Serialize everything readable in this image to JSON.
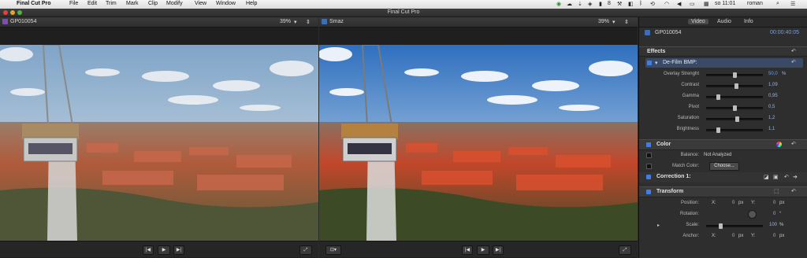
{
  "menubar": {
    "app": "Final Cut Pro",
    "items": [
      "File",
      "Edit",
      "Trim",
      "Mark",
      "Clip",
      "Modify",
      "View",
      "Window",
      "Help"
    ],
    "status": {
      "battery_count": "8",
      "clock": "so 11:01",
      "user": "roman"
    }
  },
  "window": {
    "title": "Final Cut Pro"
  },
  "viewer_left": {
    "clip_name": "GP010054",
    "zoom": "39%"
  },
  "viewer_right": {
    "clip_name": "Smaz",
    "zoom": "39%"
  },
  "inspector": {
    "tabs": [
      "Video",
      "Audio",
      "Info"
    ],
    "clip_name": "GP010054",
    "timecode": "00:00:40:05",
    "effects_heading": "Effects",
    "effect": {
      "name": "De-Film BMP:",
      "params": [
        {
          "label": "Overlay Strenght",
          "value": "50,0",
          "unit": "%",
          "level": 0.5
        },
        {
          "label": "Contrast",
          "value": "1,09",
          "unit": "",
          "level": 0.54
        },
        {
          "label": "Gamma",
          "value": "0,95",
          "unit": "",
          "level": 0.2
        },
        {
          "label": "Pivot",
          "value": "0,5",
          "unit": "",
          "level": 0.5
        },
        {
          "label": "Saturation",
          "value": "1,2",
          "unit": "",
          "level": 0.55
        },
        {
          "label": "Brightness",
          "value": "1,1",
          "unit": "",
          "level": 0.2
        }
      ]
    },
    "color": {
      "heading": "Color",
      "balance_label": "Balance:",
      "balance_value": "Not Analyzed",
      "match_label": "Match Color:",
      "match_button": "Choose...",
      "correction": "Correction 1:"
    },
    "transform": {
      "heading": "Transform",
      "position_label": "Position:",
      "x_label": "X:",
      "y_label": "Y:",
      "pos_x": "0",
      "pos_y": "0",
      "unit_px": "px",
      "rotation_label": "Rotation:",
      "rotation": "0",
      "rotation_unit": "°",
      "scale_label": "Scale:",
      "scale": "100",
      "scale_unit": "%",
      "anchor_label": "Anchor:",
      "anchor_x": "0",
      "anchor_y": "0"
    }
  },
  "colors": {
    "accent": "#3d7ee8",
    "value_blue": "#9fb3d6"
  }
}
